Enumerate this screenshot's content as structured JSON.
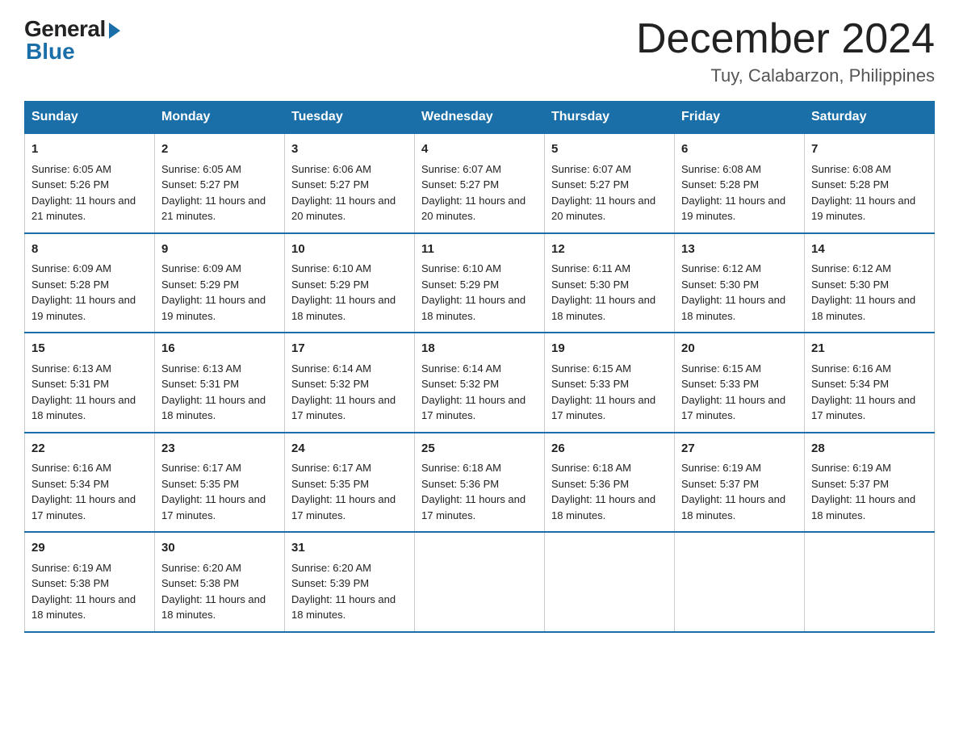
{
  "header": {
    "logo_general": "General",
    "logo_blue": "Blue",
    "month_year": "December 2024",
    "location": "Tuy, Calabarzon, Philippines"
  },
  "days_of_week": [
    "Sunday",
    "Monday",
    "Tuesday",
    "Wednesday",
    "Thursday",
    "Friday",
    "Saturday"
  ],
  "weeks": [
    [
      {
        "day": "1",
        "sunrise": "Sunrise: 6:05 AM",
        "sunset": "Sunset: 5:26 PM",
        "daylight": "Daylight: 11 hours and 21 minutes."
      },
      {
        "day": "2",
        "sunrise": "Sunrise: 6:05 AM",
        "sunset": "Sunset: 5:27 PM",
        "daylight": "Daylight: 11 hours and 21 minutes."
      },
      {
        "day": "3",
        "sunrise": "Sunrise: 6:06 AM",
        "sunset": "Sunset: 5:27 PM",
        "daylight": "Daylight: 11 hours and 20 minutes."
      },
      {
        "day": "4",
        "sunrise": "Sunrise: 6:07 AM",
        "sunset": "Sunset: 5:27 PM",
        "daylight": "Daylight: 11 hours and 20 minutes."
      },
      {
        "day": "5",
        "sunrise": "Sunrise: 6:07 AM",
        "sunset": "Sunset: 5:27 PM",
        "daylight": "Daylight: 11 hours and 20 minutes."
      },
      {
        "day": "6",
        "sunrise": "Sunrise: 6:08 AM",
        "sunset": "Sunset: 5:28 PM",
        "daylight": "Daylight: 11 hours and 19 minutes."
      },
      {
        "day": "7",
        "sunrise": "Sunrise: 6:08 AM",
        "sunset": "Sunset: 5:28 PM",
        "daylight": "Daylight: 11 hours and 19 minutes."
      }
    ],
    [
      {
        "day": "8",
        "sunrise": "Sunrise: 6:09 AM",
        "sunset": "Sunset: 5:28 PM",
        "daylight": "Daylight: 11 hours and 19 minutes."
      },
      {
        "day": "9",
        "sunrise": "Sunrise: 6:09 AM",
        "sunset": "Sunset: 5:29 PM",
        "daylight": "Daylight: 11 hours and 19 minutes."
      },
      {
        "day": "10",
        "sunrise": "Sunrise: 6:10 AM",
        "sunset": "Sunset: 5:29 PM",
        "daylight": "Daylight: 11 hours and 18 minutes."
      },
      {
        "day": "11",
        "sunrise": "Sunrise: 6:10 AM",
        "sunset": "Sunset: 5:29 PM",
        "daylight": "Daylight: 11 hours and 18 minutes."
      },
      {
        "day": "12",
        "sunrise": "Sunrise: 6:11 AM",
        "sunset": "Sunset: 5:30 PM",
        "daylight": "Daylight: 11 hours and 18 minutes."
      },
      {
        "day": "13",
        "sunrise": "Sunrise: 6:12 AM",
        "sunset": "Sunset: 5:30 PM",
        "daylight": "Daylight: 11 hours and 18 minutes."
      },
      {
        "day": "14",
        "sunrise": "Sunrise: 6:12 AM",
        "sunset": "Sunset: 5:30 PM",
        "daylight": "Daylight: 11 hours and 18 minutes."
      }
    ],
    [
      {
        "day": "15",
        "sunrise": "Sunrise: 6:13 AM",
        "sunset": "Sunset: 5:31 PM",
        "daylight": "Daylight: 11 hours and 18 minutes."
      },
      {
        "day": "16",
        "sunrise": "Sunrise: 6:13 AM",
        "sunset": "Sunset: 5:31 PM",
        "daylight": "Daylight: 11 hours and 18 minutes."
      },
      {
        "day": "17",
        "sunrise": "Sunrise: 6:14 AM",
        "sunset": "Sunset: 5:32 PM",
        "daylight": "Daylight: 11 hours and 17 minutes."
      },
      {
        "day": "18",
        "sunrise": "Sunrise: 6:14 AM",
        "sunset": "Sunset: 5:32 PM",
        "daylight": "Daylight: 11 hours and 17 minutes."
      },
      {
        "day": "19",
        "sunrise": "Sunrise: 6:15 AM",
        "sunset": "Sunset: 5:33 PM",
        "daylight": "Daylight: 11 hours and 17 minutes."
      },
      {
        "day": "20",
        "sunrise": "Sunrise: 6:15 AM",
        "sunset": "Sunset: 5:33 PM",
        "daylight": "Daylight: 11 hours and 17 minutes."
      },
      {
        "day": "21",
        "sunrise": "Sunrise: 6:16 AM",
        "sunset": "Sunset: 5:34 PM",
        "daylight": "Daylight: 11 hours and 17 minutes."
      }
    ],
    [
      {
        "day": "22",
        "sunrise": "Sunrise: 6:16 AM",
        "sunset": "Sunset: 5:34 PM",
        "daylight": "Daylight: 11 hours and 17 minutes."
      },
      {
        "day": "23",
        "sunrise": "Sunrise: 6:17 AM",
        "sunset": "Sunset: 5:35 PM",
        "daylight": "Daylight: 11 hours and 17 minutes."
      },
      {
        "day": "24",
        "sunrise": "Sunrise: 6:17 AM",
        "sunset": "Sunset: 5:35 PM",
        "daylight": "Daylight: 11 hours and 17 minutes."
      },
      {
        "day": "25",
        "sunrise": "Sunrise: 6:18 AM",
        "sunset": "Sunset: 5:36 PM",
        "daylight": "Daylight: 11 hours and 17 minutes."
      },
      {
        "day": "26",
        "sunrise": "Sunrise: 6:18 AM",
        "sunset": "Sunset: 5:36 PM",
        "daylight": "Daylight: 11 hours and 18 minutes."
      },
      {
        "day": "27",
        "sunrise": "Sunrise: 6:19 AM",
        "sunset": "Sunset: 5:37 PM",
        "daylight": "Daylight: 11 hours and 18 minutes."
      },
      {
        "day": "28",
        "sunrise": "Sunrise: 6:19 AM",
        "sunset": "Sunset: 5:37 PM",
        "daylight": "Daylight: 11 hours and 18 minutes."
      }
    ],
    [
      {
        "day": "29",
        "sunrise": "Sunrise: 6:19 AM",
        "sunset": "Sunset: 5:38 PM",
        "daylight": "Daylight: 11 hours and 18 minutes."
      },
      {
        "day": "30",
        "sunrise": "Sunrise: 6:20 AM",
        "sunset": "Sunset: 5:38 PM",
        "daylight": "Daylight: 11 hours and 18 minutes."
      },
      {
        "day": "31",
        "sunrise": "Sunrise: 6:20 AM",
        "sunset": "Sunset: 5:39 PM",
        "daylight": "Daylight: 11 hours and 18 minutes."
      },
      null,
      null,
      null,
      null
    ]
  ]
}
